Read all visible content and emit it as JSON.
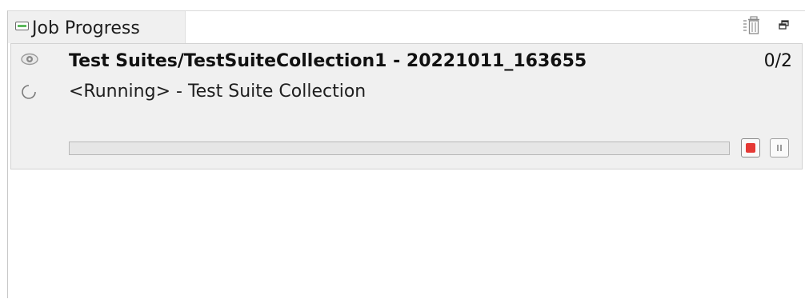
{
  "view": {
    "tab_label": "Job Progress",
    "tab_icon": "progress-view-icon",
    "toolbar": {
      "remove_all_icon": "trash-icon",
      "restore_icon": "restore-window-icon"
    }
  },
  "job": {
    "title": "Test Suites/TestSuiteCollection1 - 20221011_163655",
    "count": "0/2",
    "status": "<Running> - Test Suite Collection",
    "progress": 0,
    "icons": {
      "watch": "eye-icon",
      "busy": "spinner-icon",
      "stop": "stop-icon",
      "pause": "pause-icon"
    }
  },
  "colors": {
    "stop": "#e53935",
    "progress": "#06b025",
    "panel_bg": "#f0f0f0"
  }
}
